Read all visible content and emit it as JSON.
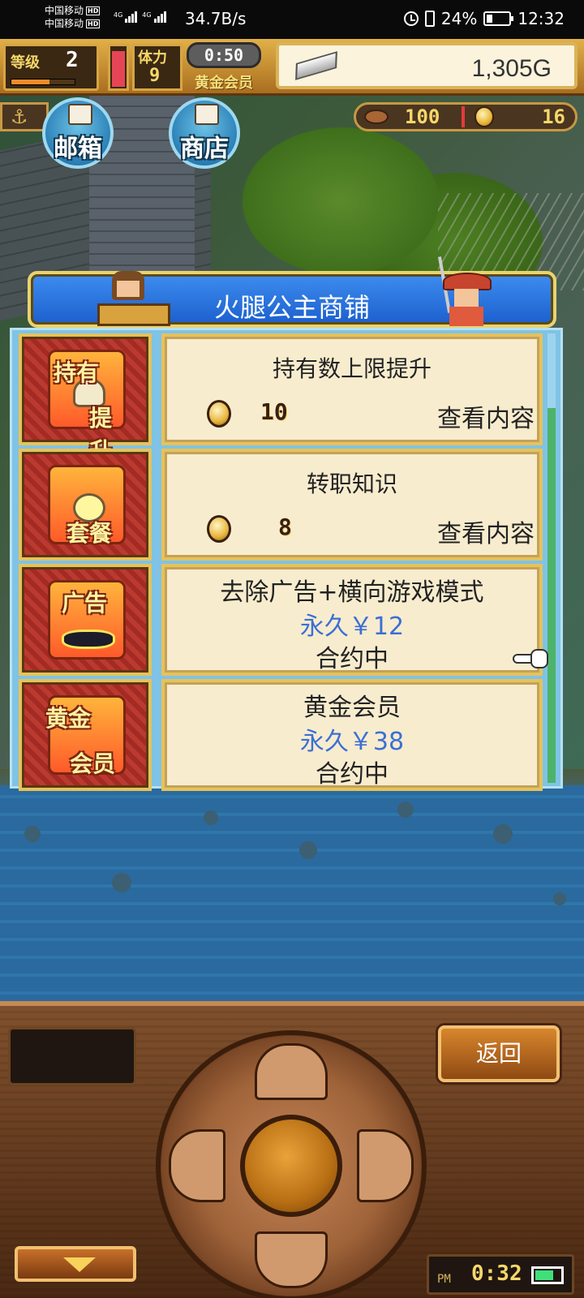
{
  "status_bar": {
    "carrier1": "中国移动",
    "carrier2": "中国移动",
    "hd": "HD",
    "net_type": "4G",
    "net_speed": "34.7B/s",
    "battery": "24%",
    "battery_level": 0.24,
    "time": "12:32"
  },
  "hud": {
    "level_label": "等级",
    "level": "2",
    "stamina_label": "体力",
    "stamina": "9",
    "timer": "0:50",
    "vip_label": "黄金会员",
    "gold": "1,305G",
    "meat": "100",
    "coins": "16"
  },
  "nav": {
    "mailbox_label": "邮箱",
    "shop_label": "商店"
  },
  "shop": {
    "title": "火腿公主商铺",
    "items": [
      {
        "icon_text1": "持有",
        "icon_text2": "提升",
        "name": "持有数上限提升",
        "price": "10",
        "action": "查看内容"
      },
      {
        "icon_text1": "",
        "icon_text2": "套餐",
        "name": "转职知识",
        "price": "8",
        "action": "查看内容"
      },
      {
        "icon_text1": "广告",
        "icon_text2": "",
        "line1": "去除广告+横向游戏模式",
        "line2": "永久￥12",
        "line3": "合约中"
      },
      {
        "icon_text1": "黄金",
        "icon_text2": "会员",
        "line1": "黄金会员",
        "line2": "永久￥38",
        "line3": "合约中"
      }
    ]
  },
  "console": {
    "back_label": "返回",
    "clock_ampm": "PM",
    "clock_time": "0:32"
  },
  "colors": {
    "price_blue": "#3b6fd6",
    "panel_blue": "#1c5fcd",
    "gold_text": "#f6d76a"
  }
}
